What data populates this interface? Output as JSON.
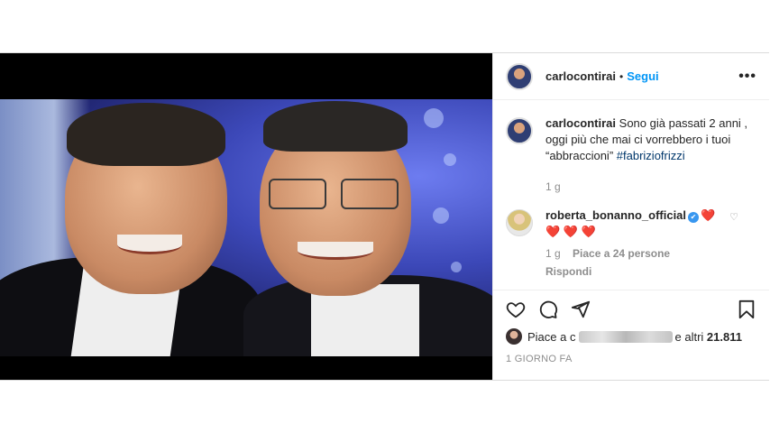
{
  "post": {
    "username": "carlocontirai",
    "follow_label": "Segui",
    "separator": "•",
    "more_label": "•••"
  },
  "caption": {
    "username": "carlocontirai",
    "text": "Sono già passati 2 anni , oggi più che mai ci vorrebbero i tuoi “abbraccioni”",
    "hashtag": "#fabriziofrizzi",
    "time": "1 g"
  },
  "comment": {
    "username": "roberta_bonanno_official",
    "verified_mark": "✔",
    "hearts_inline": "❤️",
    "hearts": "❤️ ❤️ ❤️",
    "time": "1 g",
    "likes": "Piace a 24 persone",
    "reply_label": "Rispondi",
    "like_icon": "♡"
  },
  "actions": {
    "icons": [
      "heart-icon",
      "comment-icon",
      "share-icon",
      "bookmark-icon"
    ],
    "likes_prefix": "Piace a",
    "likes_prefix_tail": "c",
    "likes_suffix": "e altri",
    "likes_count": "21.811",
    "posted": "1 GIORNO FA"
  },
  "colors": {
    "accent": "#0095f6",
    "hashtag": "#00376b",
    "muted": "#8e8e8e",
    "heart": "#ed4956"
  }
}
